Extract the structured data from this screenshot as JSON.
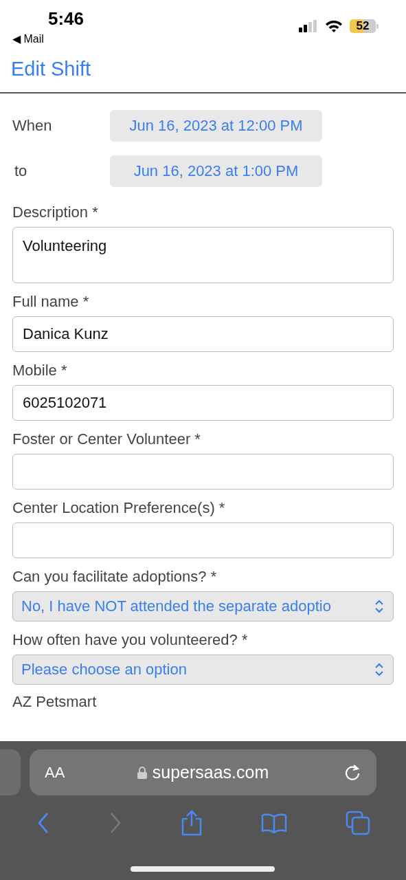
{
  "status_bar": {
    "time": "5:46",
    "back_app": "◀ Mail",
    "battery": "52"
  },
  "header": {
    "title": "Edit Shift"
  },
  "when": [
    {
      "label": "When",
      "value": "Jun 16, 2023 at 12:00 PM"
    },
    {
      "label": "to",
      "value": "Jun 16, 2023 at 1:00 PM"
    }
  ],
  "fields": [
    {
      "kind": "textarea",
      "label": "Description *",
      "value": "Volunteering"
    },
    {
      "kind": "text",
      "label": "Full name *",
      "value": "Danica Kunz"
    },
    {
      "kind": "text",
      "label": "Mobile *",
      "value": "6025102071"
    },
    {
      "kind": "text",
      "label": "Foster or Center Volunteer *"
    },
    {
      "kind": "text",
      "label": "Center Location Preference(s) *"
    },
    {
      "kind": "select",
      "label": "Can you facilitate adoptions? *",
      "value": "No, I have NOT attended the separate adoptio"
    },
    {
      "kind": "select",
      "label": "How often have you volunteered? *",
      "value": "Please choose an option"
    },
    {
      "kind": "heading",
      "label": "AZ Petsmart"
    }
  ],
  "browser": {
    "text_size": "AA",
    "url": "supersaas.com",
    "back_disabled": false,
    "forward_disabled": true
  }
}
